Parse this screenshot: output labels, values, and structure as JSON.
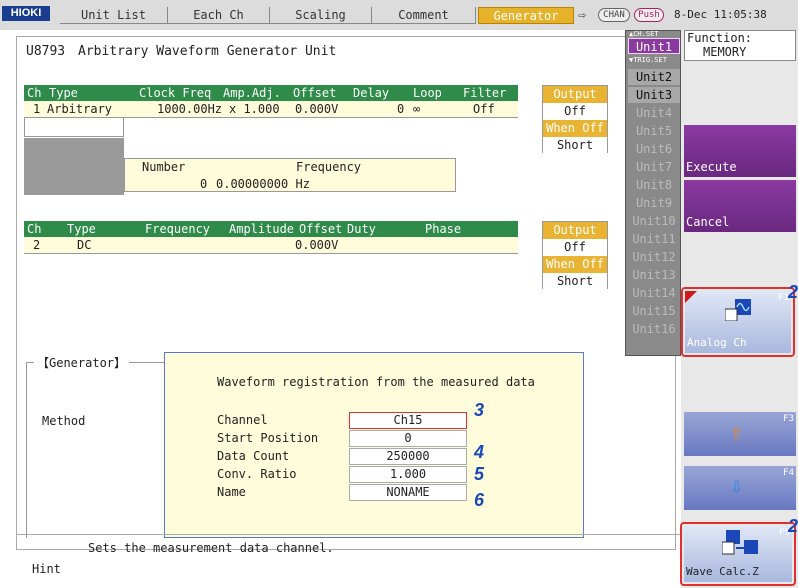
{
  "topbar": {
    "logo": "HIOKI",
    "tabs": [
      "Unit List",
      "Each Ch",
      "Scaling",
      "Comment",
      "Generator"
    ],
    "active_tab": "Generator",
    "chan_pill": "CHAN",
    "push_pill": "Push",
    "datetime": "8-Dec 11:05:38"
  },
  "header": {
    "model": "U8793",
    "title": "Arbitrary Waveform Generator Unit"
  },
  "ch1": {
    "headers": [
      "Ch",
      "Type",
      "Clock Freq",
      "Amp.Adj.",
      "Offset",
      "Delay",
      "Loop",
      "Filter"
    ],
    "row": [
      "1",
      "Arbitrary",
      "1000.00Hz",
      "x 1.000",
      "0.000V",
      "0",
      "∞",
      "Off"
    ],
    "number_label": "Number",
    "frequency_label": "Frequency",
    "number": "0",
    "frequency": "0.00000000 Hz"
  },
  "ch2": {
    "headers": [
      "Ch",
      "Type",
      "Frequency",
      "Amplitude",
      "Offset",
      "Duty",
      "Phase"
    ],
    "row": [
      "2",
      "DC",
      "",
      "",
      "0.000V",
      "",
      ""
    ]
  },
  "output1": {
    "label": "Output",
    "value": "Off",
    "when_label": "When Off",
    "when_value": "Short"
  },
  "output2": {
    "label": "Output",
    "value": "Off",
    "when_label": "When Off",
    "when_value": "Short"
  },
  "units": {
    "chset": "▲CH.SET",
    "trigset": "▼TRIG.SET",
    "items": [
      "Unit1",
      "Unit2",
      "Unit3",
      "Unit4",
      "Unit5",
      "Unit6",
      "Unit7",
      "Unit8",
      "Unit9",
      "Unit10",
      "Unit11",
      "Unit12",
      "Unit13",
      "Unit14",
      "Unit15",
      "Unit16"
    ],
    "selected": "Unit1"
  },
  "function": {
    "label": "Function:",
    "value": "MEMORY"
  },
  "buttons": {
    "execute": "Execute",
    "cancel": "Cancel",
    "f1_label": "Analog Ch",
    "f1_key": "F1",
    "f3_key": "F3",
    "f4_key": "F4",
    "f5_label": "Wave Calc.Z",
    "f5_key": "F5"
  },
  "generator": {
    "group_label": "【Generator】",
    "method_label": "Method"
  },
  "dialog": {
    "title": "Waveform registration from the measured data",
    "fields": [
      {
        "label": "Channel",
        "value": "Ch15"
      },
      {
        "label": "Start Position",
        "value": "0"
      },
      {
        "label": "Data Count",
        "value": "250000"
      },
      {
        "label": "Conv. Ratio",
        "value": "1.000"
      },
      {
        "label": "Name",
        "value": "NONAME"
      }
    ]
  },
  "callouts": {
    "n2a": "2",
    "n2b": "2",
    "n3": "3",
    "n4": "4",
    "n5": "5",
    "n6": "6"
  },
  "hint": {
    "label": "Hint",
    "text": "Sets the  measurement data channel."
  }
}
